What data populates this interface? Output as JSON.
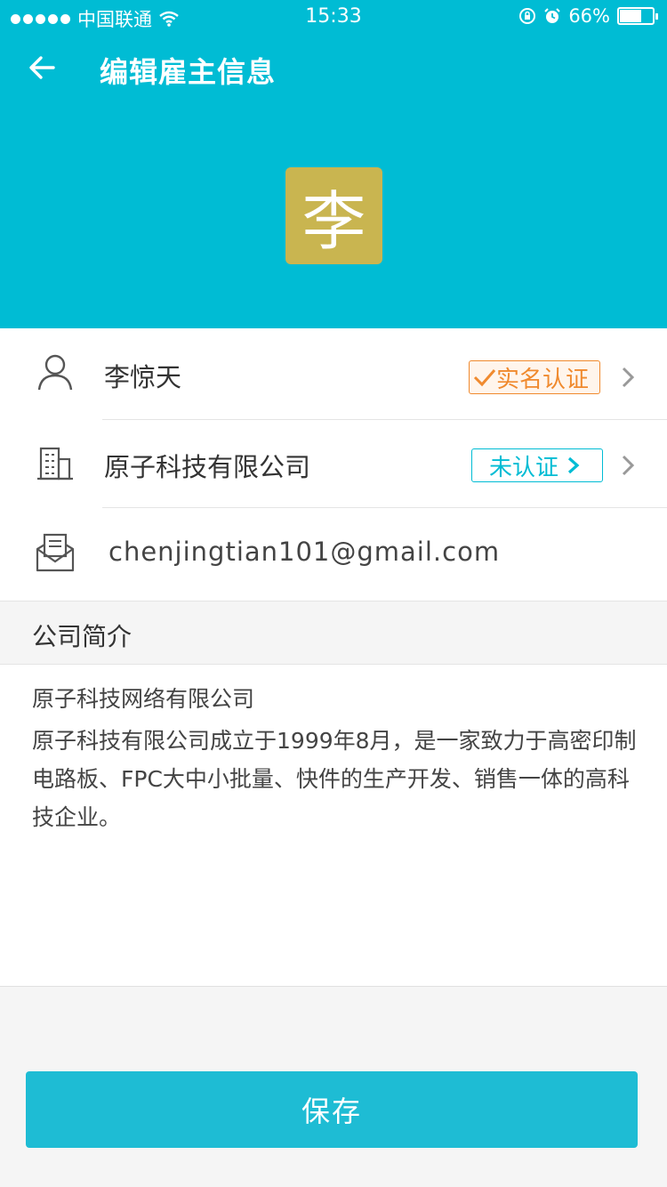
{
  "status_bar": {
    "carrier": "中国联通",
    "time": "15:33",
    "battery_percent": "66%",
    "battery_level": 0.66
  },
  "nav": {
    "title": "编辑雇主信息"
  },
  "avatar": {
    "text": "李",
    "color": "#c9b550"
  },
  "info": {
    "name": "李惊天",
    "name_badge": "实名认证",
    "company": "原子科技有限公司",
    "company_badge": "未认证",
    "email": "chenjingtian101@gmail.com"
  },
  "intro": {
    "section_title": "公司简介",
    "title": "原子科技网络有限公司",
    "body": "原子科技有限公司成立于1999年8月，是一家致力于高密印制电路板、FPC大中小批量、快件的生产开发、销售一体的高科技企业。"
  },
  "save_button": "保存",
  "colors": {
    "primary": "#00bcd4",
    "verified": "#f08a2e"
  }
}
